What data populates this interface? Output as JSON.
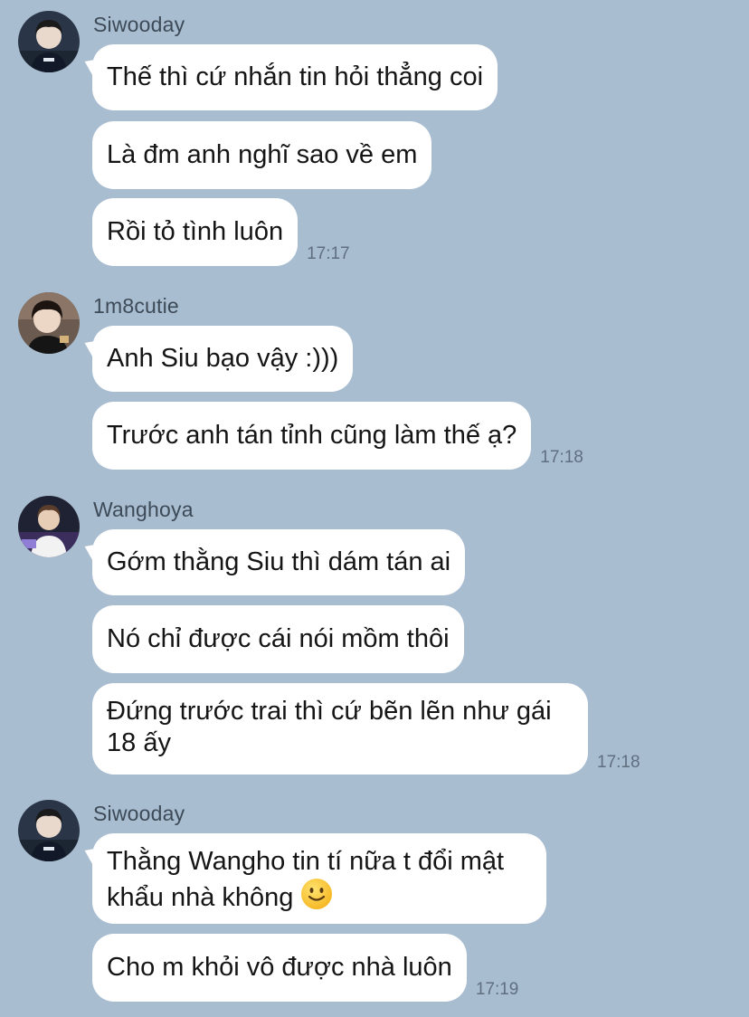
{
  "chat": {
    "groups": [
      {
        "sender": "Siwooday",
        "avatar_icon": "siwooday-avatar-icon",
        "messages": [
          {
            "text": "Thế thì cứ nhắn tin hỏi thẳng coi"
          },
          {
            "text": "Là đm anh nghĩ sao về em"
          },
          {
            "text": "Rồi tỏ tình luôn",
            "time": "17:17"
          }
        ]
      },
      {
        "sender": "1m8cutie",
        "avatar_icon": "1m8cutie-avatar-icon",
        "messages": [
          {
            "text": "Anh Siu bạo vậy :)))"
          },
          {
            "text": "Trước anh tán tỉnh cũng làm thế ạ?",
            "time": "17:18"
          }
        ]
      },
      {
        "sender": "Wanghoya",
        "avatar_icon": "wanghoya-avatar-icon",
        "messages": [
          {
            "text": "Gớm thằng Siu thì dám tán ai"
          },
          {
            "text": "Nó chỉ được cái nói mồm thôi"
          },
          {
            "line1": "Đứng trước trai thì cứ bẽn lẽn như gái",
            "line2": "18 ấy",
            "time": "17:18"
          }
        ]
      },
      {
        "sender": "Siwooday",
        "avatar_icon": "siwooday-avatar-icon",
        "messages": [
          {
            "line1": "Thằng Wangho tin tí nữa t đổi mật",
            "line2": "khẩu nhà không",
            "emoji": "slightly-smiling-face-icon"
          },
          {
            "text": "Cho m khỏi vô được nhà luôn",
            "time": "17:19"
          }
        ]
      }
    ]
  },
  "colors": {
    "background": "#a9bdd1",
    "bubble": "#ffffff",
    "sender_text": "#3d4a57",
    "time_text": "#5f6f80"
  }
}
